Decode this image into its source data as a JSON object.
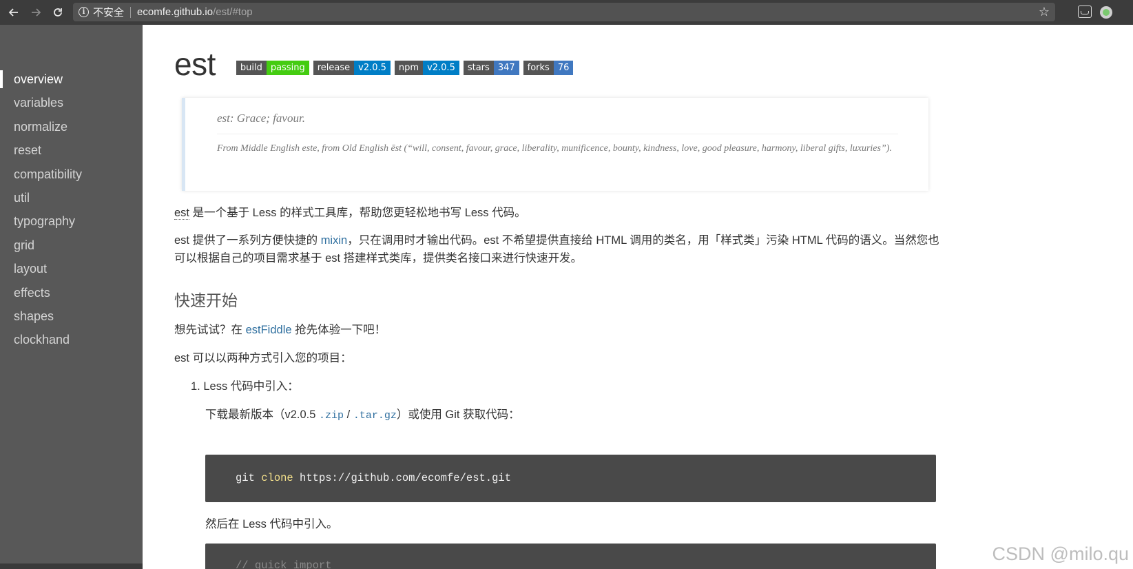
{
  "browser": {
    "security_label": "不安全",
    "url_host": "ecomfe.github.io",
    "url_path": "/est/#top"
  },
  "sidebar": {
    "items": [
      {
        "label": "overview"
      },
      {
        "label": "variables"
      },
      {
        "label": "normalize"
      },
      {
        "label": "reset"
      },
      {
        "label": "compatibility"
      },
      {
        "label": "util"
      },
      {
        "label": "typography"
      },
      {
        "label": "grid"
      },
      {
        "label": "layout"
      },
      {
        "label": "effects"
      },
      {
        "label": "shapes"
      },
      {
        "label": "clockhand"
      }
    ]
  },
  "main": {
    "title": "est",
    "badges": [
      {
        "left": "build",
        "right": "passing",
        "color": "#4c1"
      },
      {
        "left": "release",
        "right": "v2.0.5",
        "color": "#007ec6"
      },
      {
        "left": "npm",
        "right": "v2.0.5",
        "color": "#007ec6"
      },
      {
        "left": "stars",
        "right": "347",
        "color": "#4078c0"
      },
      {
        "left": "forks",
        "right": "76",
        "color": "#4078c0"
      }
    ],
    "quote": {
      "line1": "est: Grace; favour.",
      "line2": "From Middle English este, from Old English ēst (“will, consent, favour, grace, liberality, munificence, bounty, kindness, love, good pleasure, harmony, liberal gifts, luxuries”)."
    },
    "para1": {
      "abbr": "est",
      "text": " 是一个基于 Less 的样式工具库，帮助您更轻松地书写 Less 代码。"
    },
    "para2": {
      "before": "est 提供了一系列方便快捷的 ",
      "link": "mixin",
      "after": "，只在调用时才输出代码。est 不希望提供直接给 HTML 调用的类名，用「样式类」污染 HTML 代码的语义。当然您也可以根据自己的项目需求基于 est 搭建样式类库，提供类名接口来进行快速开发。"
    },
    "quickstart_heading": "快速开始",
    "para3": {
      "before": "想先试试？在 ",
      "link": "estFiddle",
      "after": " 抢先体验一下吧！"
    },
    "para4": "est 可以以两种方式引入您的项目：",
    "list_item1": "1. Less 代码中引入：",
    "download": {
      "before": "下载最新版本（v2.0.5 ",
      "zip": ".zip",
      "slash": " / ",
      "targz": ".tar.gz",
      "after": "）或使用 Git 获取代码："
    },
    "code1": {
      "cmd": "git",
      "kw": "clone",
      "arg": "https://github.com/ecomfe/est.git"
    },
    "then_text": "然后在 Less 代码中引入。",
    "code2_comment": "// quick import"
  },
  "watermark": "CSDN @milo.qu"
}
